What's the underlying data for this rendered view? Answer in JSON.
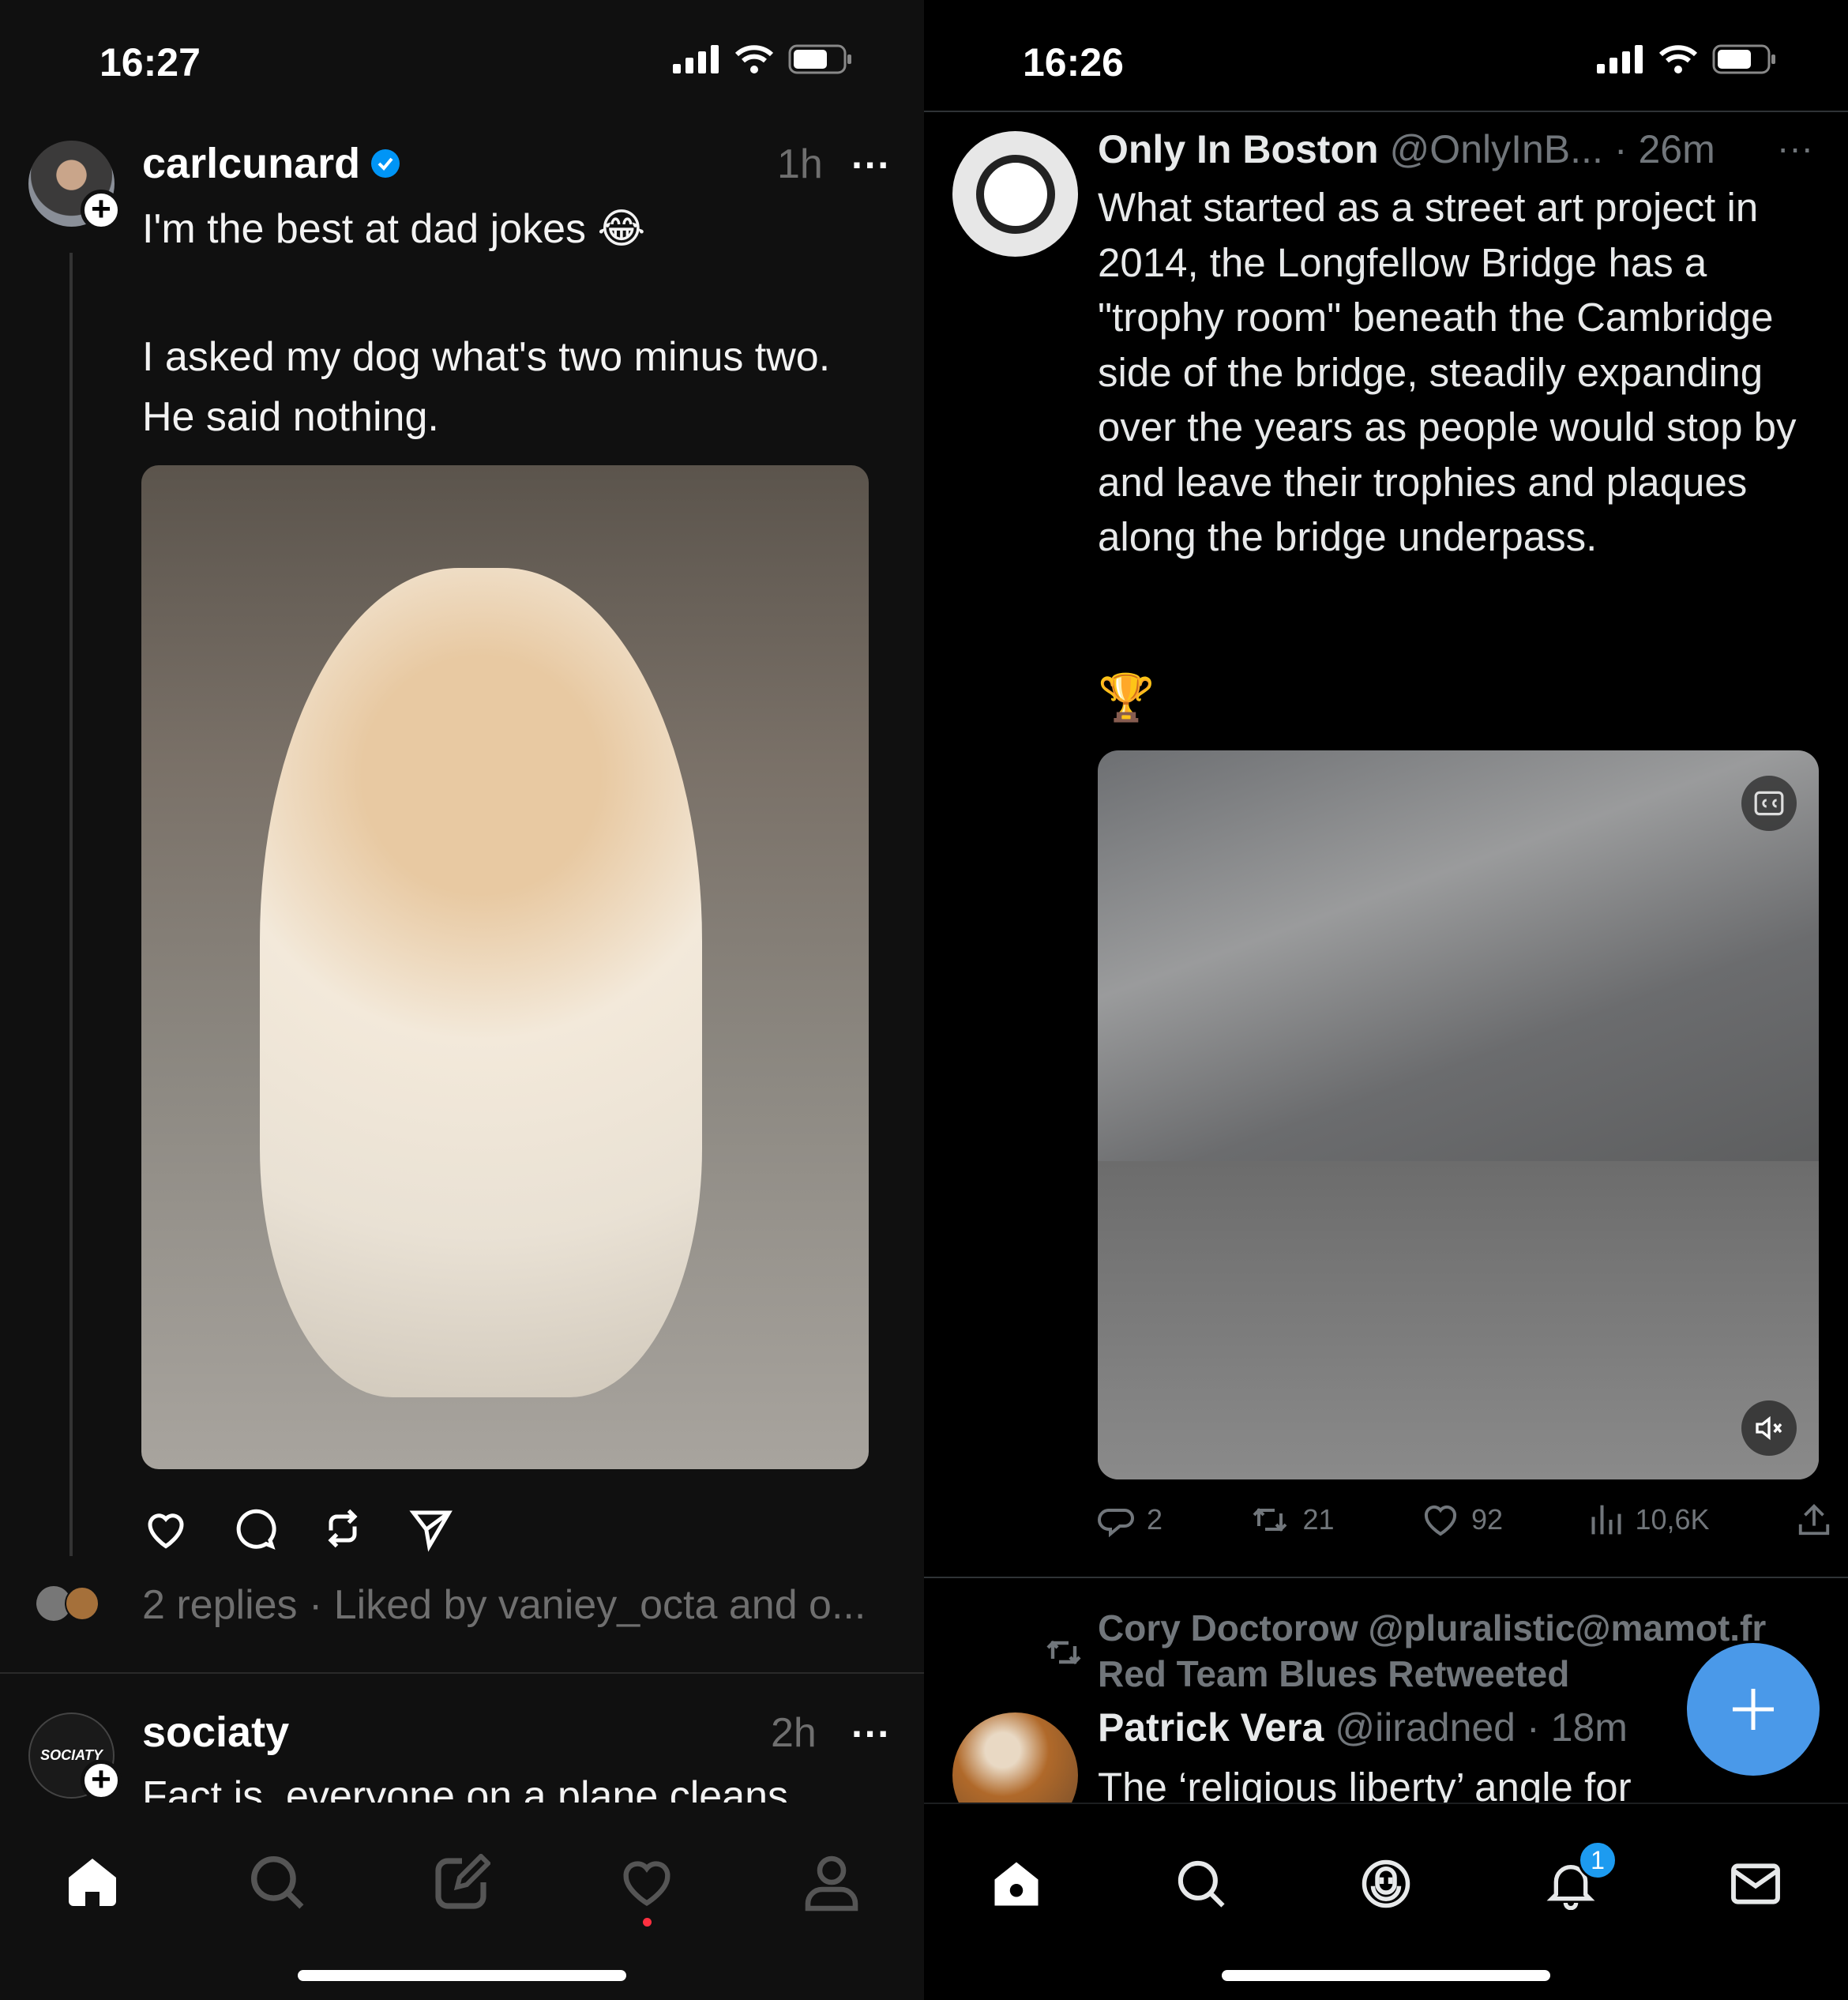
{
  "left": {
    "status_time": "16:27",
    "post1": {
      "username": "carlcunard",
      "verified": true,
      "time": "1h",
      "line1": "I'm the best at dad jokes 😂",
      "body": "I asked my dog what's two minus two. He said nothing.",
      "meta": "2 replies · Liked by vaniey_octa and o..."
    },
    "post2": {
      "username": "sociaty",
      "avatar_text": "SOCIATY",
      "time": "2h",
      "text": "Fact is, everyone on a plane cleans"
    },
    "nav": [
      "home-icon",
      "search-icon",
      "compose-icon",
      "heart-icon",
      "profile-icon"
    ]
  },
  "right": {
    "status_time": "16:26",
    "tweet1": {
      "name": "Only In Boston",
      "handle": "@OnlyInB...",
      "sep": "·",
      "time": "26m",
      "text": "What started as a street art project in 2014, the Longfellow Bridge has a \"trophy room\" beneath the Cambridge side of the bridge, steadily expanding over the years as people would stop by and leave their trophies and plaques along the bridge underpass.",
      "emoji": "🏆",
      "replies": "2",
      "retweets": "21",
      "likes": "92",
      "views": "10,6K"
    },
    "retweet_context": {
      "line1": "Cory Doctorow @pluralistic@mamot.fr",
      "line2": "Red Team Blues Retweeted"
    },
    "tweet2": {
      "name": "Patrick Vera",
      "handle": "@iiradned",
      "sep": "·",
      "time": "18m",
      "text": "The ‘religious liberty’ angle for"
    },
    "notification_badge": "1",
    "fab_color": "#4a99e9",
    "nav": [
      "home-icon",
      "search-icon",
      "spaces-icon",
      "notifications-icon",
      "messages-icon"
    ]
  }
}
